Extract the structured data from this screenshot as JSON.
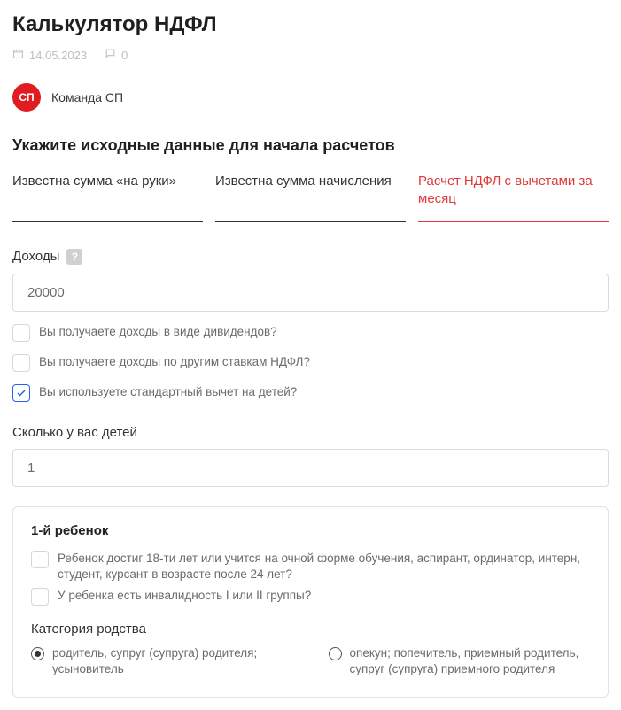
{
  "page": {
    "title": "Калькулятор НДФЛ",
    "date": "14.05.2023",
    "comments_count": "0"
  },
  "author": {
    "avatar_initials": "СП",
    "name": "Команда СП"
  },
  "form": {
    "heading": "Укажите исходные данные для начала расчетов",
    "tabs": [
      {
        "label": "Известна сумма «на руки»"
      },
      {
        "label": "Известна сумма начисления"
      },
      {
        "label": "Расчет НДФЛ с вычетами за месяц"
      }
    ],
    "income": {
      "label": "Доходы",
      "value": "20000"
    },
    "checkboxes": {
      "dividends": "Вы получаете доходы в виде дивидендов?",
      "other_rates": "Вы получаете доходы по другим ставкам НДФЛ?",
      "child_deduction": "Вы используете стандартный вычет на детей?"
    },
    "children": {
      "label": "Сколько у вас детей",
      "value": "1"
    },
    "child_card": {
      "title": "1-й ребенок",
      "age_question": "Ребенок достиг 18-ти лет или учится на очной форме обучения, аспирант, ординатор, интерн, студент, курсант в возрасте после 24 лет?",
      "disability_question": "У ребенка есть инвалидность I или II группы?",
      "relation_label": "Категория родства",
      "relation_options": {
        "parent": "родитель, супруг (супруга) родителя; усыновитель",
        "guardian": "опекун; попечитель, приемный родитель, супруг (супруга) приемного родителя"
      }
    }
  }
}
